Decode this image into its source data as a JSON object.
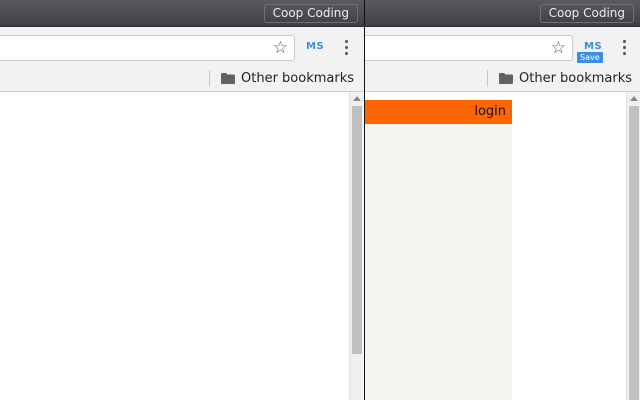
{
  "left_window": {
    "profile_button": "Coop Coding",
    "extension_label": "MS",
    "bookmarks": {
      "other_bookmarks": "Other bookmarks"
    }
  },
  "right_window": {
    "profile_button": "Coop Coding",
    "extension_label": "MS",
    "extension_tooltip": "Save",
    "bookmarks": {
      "other_bookmarks": "Other bookmarks"
    },
    "page": {
      "login_link": "login"
    }
  },
  "colors": {
    "titlebar": "#4a4a4f",
    "accent_login_bar": "#ff6600",
    "panel_bg": "#f5f4ee",
    "extension_blue": "#3a8ee6"
  },
  "icons": [
    "star-icon",
    "folder-icon",
    "menu-dots-icon",
    "scroll-up-icon"
  ]
}
